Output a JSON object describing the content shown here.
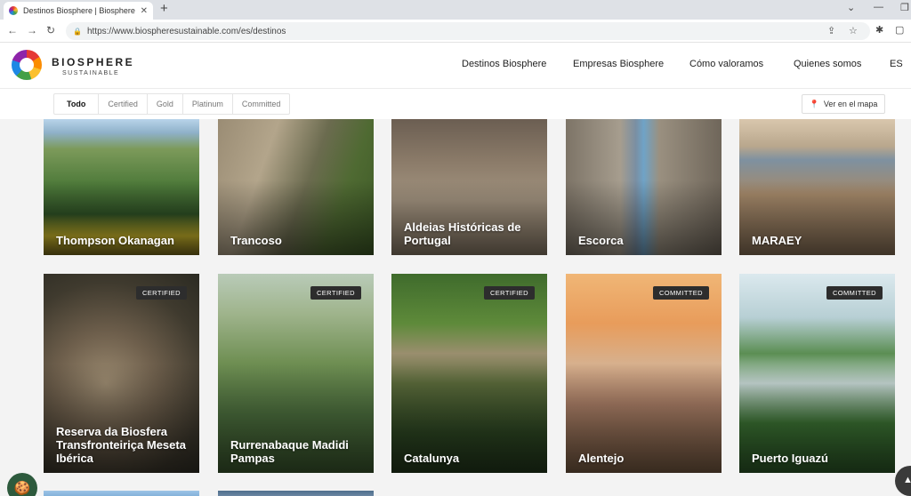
{
  "browser": {
    "tab_title": "Destinos Biosphere | Biosphere S",
    "tab_close": "✕",
    "new_tab": "+",
    "url": "https://www.biospheresustainable.com/es/destinos",
    "back": "←",
    "forward": "→",
    "reload": "↻",
    "lock": "🔒",
    "share": "⇪",
    "star": "☆",
    "extensions": "✱",
    "sidepanel": "▢",
    "chevron": "⌄",
    "minimize": "—",
    "restore": "❐"
  },
  "header": {
    "logo_name": "BIOSPHERE",
    "logo_sub": "SUSTAINABLE",
    "nav": [
      {
        "label": "Destinos Biosphere"
      },
      {
        "label": "Empresas Biosphere"
      },
      {
        "label": "Cómo valoramos"
      },
      {
        "label": "Quienes somos"
      },
      {
        "label": "ES"
      }
    ]
  },
  "filters": {
    "items": [
      {
        "label": "Todo"
      },
      {
        "label": "Certified"
      },
      {
        "label": "Gold"
      },
      {
        "label": "Platinum"
      },
      {
        "label": "Committed"
      }
    ],
    "active": "Todo",
    "map_button": "Ver en el mapa",
    "map_icon": "📍"
  },
  "destinations_row1": [
    {
      "name": "Thompson Okanagan",
      "badge": ""
    },
    {
      "name": "Trancoso",
      "badge": ""
    },
    {
      "name": "Aldeias Históricas de Portugal",
      "badge": ""
    },
    {
      "name": "Escorca",
      "badge": ""
    },
    {
      "name": "MARAEY",
      "badge": ""
    }
  ],
  "destinations_row2": [
    {
      "name": "Reserva da Biosfera Transfronteiriça Meseta Ibérica",
      "badge": "CERTIFIED"
    },
    {
      "name": "Rurrenabaque Madidi Pampas",
      "badge": "CERTIFIED"
    },
    {
      "name": "Catalunya",
      "badge": "CERTIFIED"
    },
    {
      "name": "Alentejo",
      "badge": "COMMITTED"
    },
    {
      "name": "Puerto Iguazú",
      "badge": "COMMITTED"
    }
  ],
  "widgets": {
    "cookie_icon": "🍪",
    "scroll_top_icon": "▲"
  },
  "colors": {
    "badge_bg": "#2d2d2d",
    "cookie_bg": "#2d5a3d",
    "page_bg": "#f3f3f3"
  }
}
